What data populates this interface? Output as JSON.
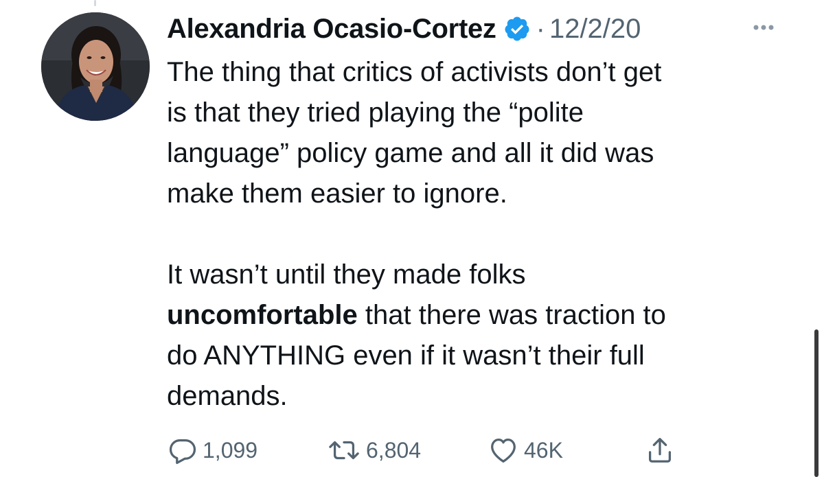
{
  "tweet": {
    "author": {
      "name": "Alexandria Ocasio-Cortez",
      "verified": true,
      "verified_color": "#1d9bf0"
    },
    "separator": "·",
    "date": "12/2/20",
    "body": {
      "paragraph1": [
        "The thing that critics of activists don’t get",
        "is that they tried playing the “polite",
        "language” policy game and all it did was",
        "make them easier to ignore."
      ],
      "paragraph2": {
        "line1": "It wasn’t until they made folks",
        "line2_bold": "uncomfortable",
        "line2_rest": " that there was traction to",
        "line3": "do ANYTHING even if it wasn’t their full",
        "line4": "demands."
      }
    },
    "actions": {
      "reply_count": "1,099",
      "retweet_count": "6,804",
      "like_count": "46K"
    },
    "icons": {
      "more": "more-horizontal-icon",
      "reply": "reply-icon",
      "retweet": "retweet-icon",
      "like": "heart-icon",
      "share": "share-icon"
    },
    "colors": {
      "text": "#0f1419",
      "secondary": "#536471",
      "verified": "#1d9bf0"
    }
  }
}
